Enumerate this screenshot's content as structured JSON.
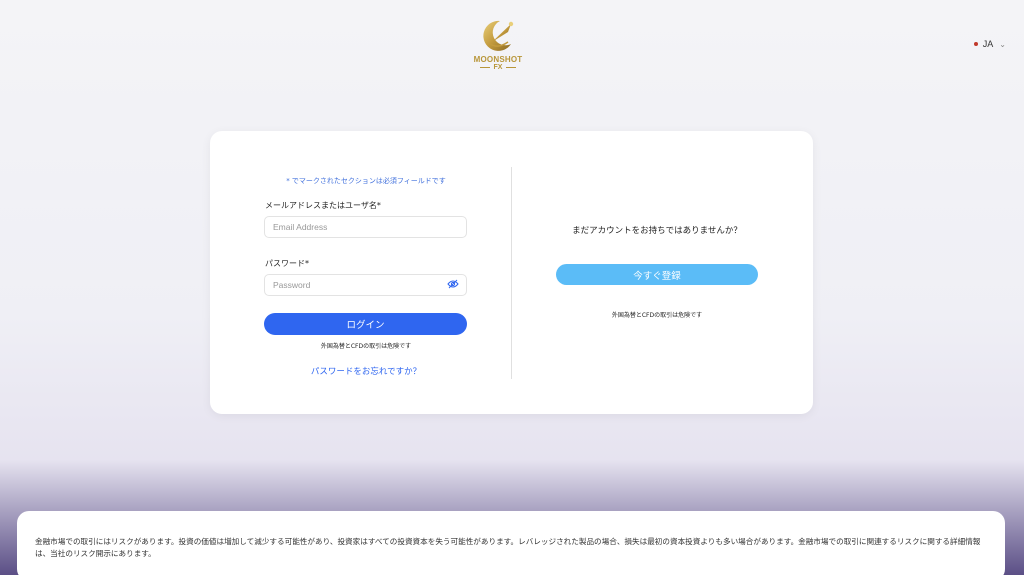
{
  "brand": {
    "name": "MOONSHOT",
    "sub": "FX",
    "gold_color": "#b8963a"
  },
  "language": {
    "current": "JA"
  },
  "login": {
    "required_note": "* でマークされたセクションは必須フィールドです",
    "email_label": "メールアドレスまたはユーザ名*",
    "email_placeholder": "Email Address",
    "email_value": "",
    "password_label": "パスワード*",
    "password_placeholder": "Password",
    "password_value": "",
    "login_button": "ログイン",
    "risk_note": "外国為替とCFDの取引は危険です",
    "forgot_link": "パスワードをお忘れですか？",
    "accent_color": "#2f66f0"
  },
  "register": {
    "title": "まだアカウントをお持ちではありませんか？",
    "button": "今すぐ登録",
    "risk_note": "外国為替とCFDの取引は危険です",
    "button_color": "#5bbcf7"
  },
  "footer": {
    "disclaimer": "金融市場での取引にはリスクがあります。投資の価値は増加して減少する可能性があり、投資家はすべての投資資本を失う可能性があります。レバレッジされた製品の場合、損失は最初の資本投資よりも多い場合があります。金融市場での取引に関連するリスクに関する詳細情報は、当社のリスク開示にあります。"
  },
  "icons": {
    "logo": "moon-rocket-logo-icon",
    "eye": "eye-off-icon",
    "language_chevron": "chevron-down-icon"
  }
}
